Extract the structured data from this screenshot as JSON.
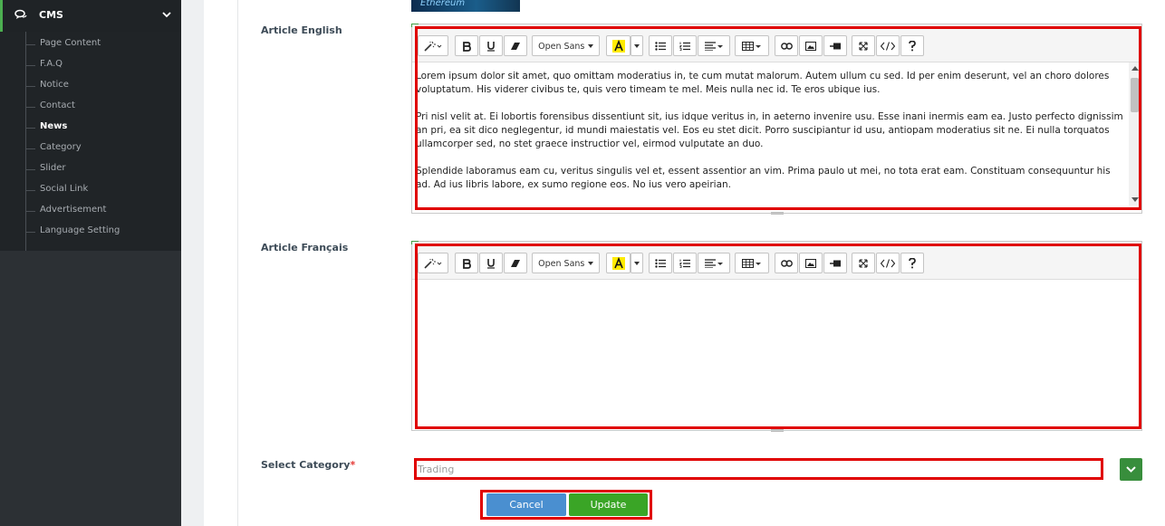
{
  "sidebar": {
    "section": {
      "label": "CMS",
      "icon": "chat-icon",
      "toggle_icon": "chevron-down-icon"
    },
    "items": [
      {
        "label": "Page Content",
        "active": false
      },
      {
        "label": "F.A.Q",
        "active": false
      },
      {
        "label": "Notice",
        "active": false
      },
      {
        "label": "Contact",
        "active": false
      },
      {
        "label": "News",
        "active": true
      },
      {
        "label": "Category",
        "active": false
      },
      {
        "label": "Slider",
        "active": false
      },
      {
        "label": "Social Link",
        "active": false
      },
      {
        "label": "Advertisement",
        "active": false
      },
      {
        "label": "Language Setting",
        "active": false
      }
    ]
  },
  "image_preview": {
    "caption": "Ethereum"
  },
  "article_english": {
    "label": "Article English",
    "font_name": "Open Sans",
    "paragraphs": [
      "Lorem ipsum dolor sit amet, quo omittam moderatius in, te cum mutat malorum. Autem ullum cu sed. Id per enim deserunt, vel an choro dolores voluptatum. His viderer civibus te, quis vero timeam te mel. Meis nulla nec id. Te eros ubique ius.",
      "Pri nisl velit at. Ei lobortis forensibus dissentiunt sit, ius idque veritus in, in aeterno invenire usu. Esse inani inermis eam ea. Justo perfecto dignissim an pri, ea sit dico neglegentur, id mundi maiestatis vel. Eos eu stet dicit. Porro suscipiantur id usu, antiopam moderatius sit ne. Ei nulla torquatos ullamcorper sed, no stet graece instructior vel, eirmod vulputate an duo.",
      "Splendide laboramus eam cu, veritus singulis vel et, essent assentior an vim. Prima paulo ut mei, no tota erat eam. Constituam consequuntur his ad. Ad ius libris labore, ex sumo regione eos. No ius vero apeirian."
    ]
  },
  "article_french": {
    "label": "Article Français",
    "font_name": "Open Sans",
    "paragraphs": []
  },
  "category": {
    "label": "Select Category",
    "required_mark": "*",
    "placeholder": "Trading"
  },
  "actions": {
    "cancel_label": "Cancel",
    "update_label": "Update"
  },
  "colors": {
    "sidebar_bg": "#2c3034",
    "accent_green": "#3aa526",
    "cancel_blue": "#4a8fd0",
    "highlight_red": "#e00000"
  }
}
